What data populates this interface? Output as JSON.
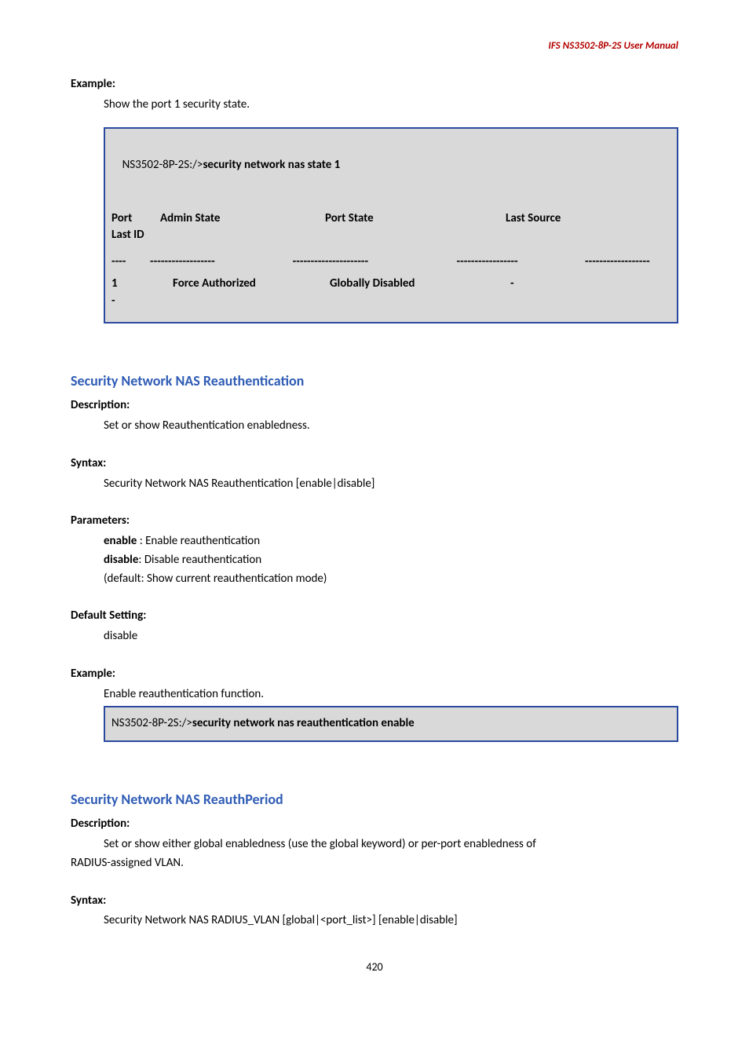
{
  "header": {
    "product": "IFS  NS3502-8P-2S  User  Manual"
  },
  "example1": {
    "label": "Example:",
    "text": "Show the port 1 security state.",
    "cmd_prefix": "NS3502-8P-2S:/>",
    "cmd_bold": "security network nas state 1",
    "th_port": "Port",
    "th_admin": "Admin State",
    "th_state": "Port State",
    "th_last": "Last Source",
    "th_lastid": "Last ID",
    "dash1": "----",
    "dash2": "------------------",
    "dash3": "---------------------",
    "dash4": "-----------------",
    "dash5": "------------------",
    "row_port": "1",
    "row_admin": "Force Authorized",
    "row_state": "Globally Disabled",
    "row_last": "-",
    "row_trail": "-"
  },
  "sec1": {
    "title": "Security Network NAS Reauthentication",
    "desc_label": "Description:",
    "desc_text": "Set or show Reauthentication enabledness.",
    "syntax_label": "Syntax:",
    "syntax_text": "Security Network NAS Reauthentication [enable|disable]",
    "params_label": "Parameters:",
    "param1_bold": "enable",
    "param1_rest": " : Enable reauthentication",
    "param2_bold": "disable",
    "param2_rest": ": Disable reauthentication",
    "param3": "(default: Show current reauthentication mode)",
    "default_label": "Default Setting:",
    "default_text": "disable",
    "example_label": "Example:",
    "example_text": "Enable reauthentication function.",
    "cmd_prefix": "NS3502-8P-2S:/>",
    "cmd_bold": "security network nas reauthentication enable"
  },
  "sec2": {
    "title": "Security Network NAS ReauthPeriod",
    "desc_label": "Description:",
    "desc_text1": "Set or show either global enabledness (use the global keyword) or per-port enabledness of",
    "desc_text2": "RADIUS-assigned VLAN.",
    "syntax_label": "Syntax:",
    "syntax_text": "Security Network NAS RADIUS_VLAN [global|<port_list>] [enable|disable]"
  },
  "page": {
    "num": "420"
  }
}
